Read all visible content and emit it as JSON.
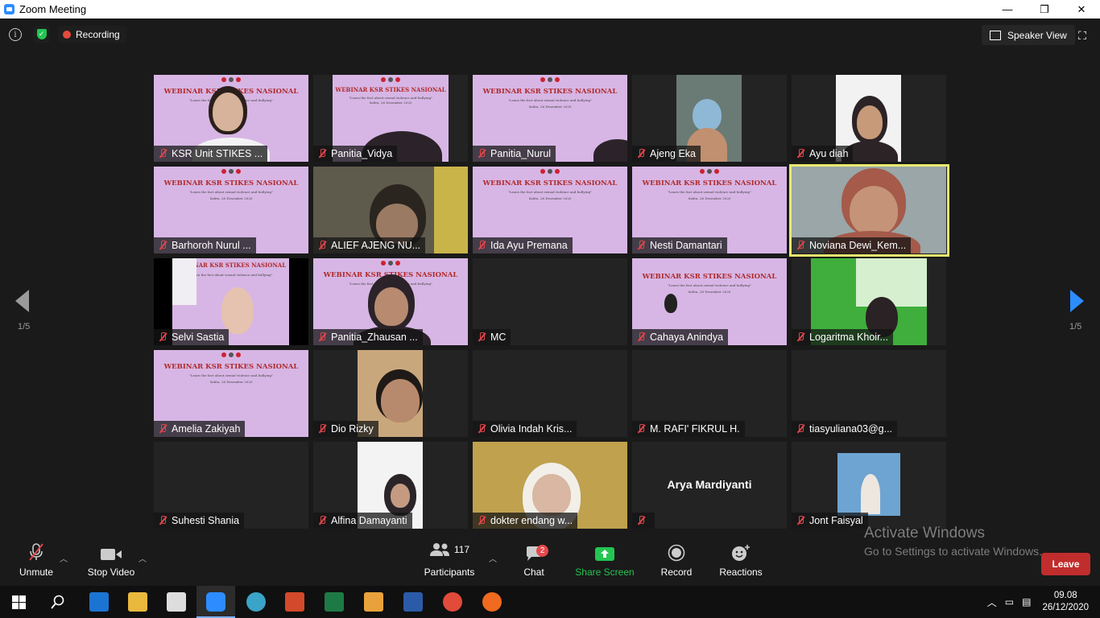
{
  "window": {
    "title": "Zoom Meeting",
    "minimize": "—",
    "maximize": "❐",
    "close": "✕"
  },
  "meeting_bar": {
    "recording_label": "Recording",
    "speaker_view_label": "Speaker View"
  },
  "tiles": [
    {
      "name": "KSR Unit STIKES ..."
    },
    {
      "name": "Panitia_Vidya"
    },
    {
      "name": "Panitia_Nurul"
    },
    {
      "name": "Ajeng Eka"
    },
    {
      "name": "Ayu diah"
    },
    {
      "name": "Barhoroh Nurul ..."
    },
    {
      "name": "ALIEF AJENG NU..."
    },
    {
      "name": "Ida Ayu Premana"
    },
    {
      "name": "Nesti Damantari"
    },
    {
      "name": "Noviana Dewi_Kem..."
    },
    {
      "name": "Selvi Sastia"
    },
    {
      "name": "Panitia_Zhausan ..."
    },
    {
      "name": "MC"
    },
    {
      "name": "Cahaya Anindya"
    },
    {
      "name": "Logaritma Khoir..."
    },
    {
      "name": "Amelia Zakiyah"
    },
    {
      "name": "Dio Rizky"
    },
    {
      "name": "Olivia Indah Kris..."
    },
    {
      "name": "M. RAFI' FIKRUL H."
    },
    {
      "name": "tiasyuliana03@g..."
    },
    {
      "name": "Suhesti Shania"
    },
    {
      "name": "Alfina Damayanti"
    },
    {
      "name": "dokter endang w..."
    },
    {
      "name": "",
      "display_name": "Arya Mardiyanti"
    },
    {
      "name": "Jont Faisyal"
    }
  ],
  "slide": {
    "title": "WEBINAR KSR STIKES NASIONAL",
    "subtitle": "\"Learn the fact about sexual violence and bullying\"",
    "date": "Sabtu, 26 Desember 2020"
  },
  "pagination": {
    "left": "1/5",
    "right": "1/5"
  },
  "watermark": {
    "line1": "Activate Windows",
    "line2": "Go to Settings to activate Windows."
  },
  "toolbar": {
    "unmute": "Unmute",
    "stop_video": "Stop Video",
    "participants": "Participants",
    "participants_count": "117",
    "chat": "Chat",
    "chat_badge": "2",
    "share_screen": "Share Screen",
    "record": "Record",
    "reactions": "Reactions",
    "leave": "Leave"
  },
  "taskbar": {
    "time": "09.08",
    "date": "26/12/2020"
  },
  "colors": {
    "accent": "#2d8cff",
    "share_green": "#23c552",
    "leave_red": "#c12d2d",
    "active_speaker": "#e8e870"
  }
}
